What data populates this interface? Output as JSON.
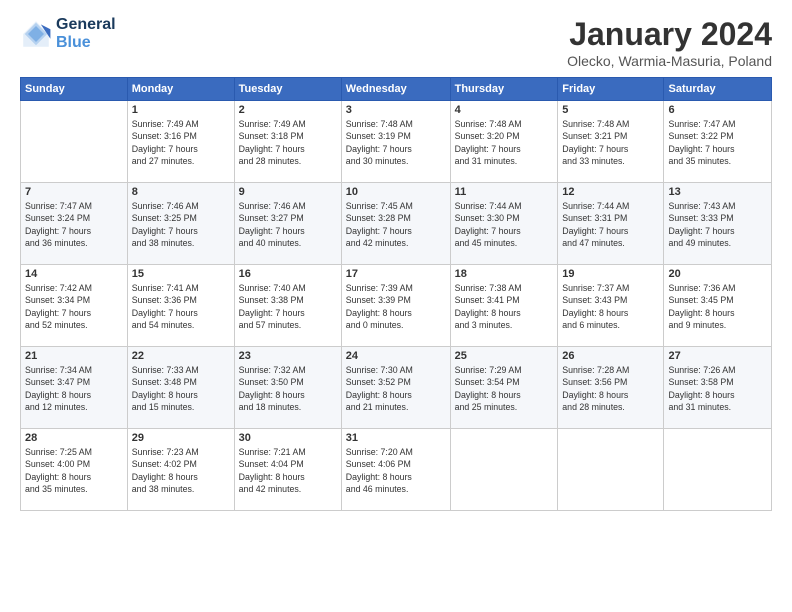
{
  "logo": {
    "line1": "General",
    "line2": "Blue"
  },
  "title": "January 2024",
  "subtitle": "Olecko, Warmia-Masuria, Poland",
  "header_days": [
    "Sunday",
    "Monday",
    "Tuesday",
    "Wednesday",
    "Thursday",
    "Friday",
    "Saturday"
  ],
  "weeks": [
    [
      {
        "day": "",
        "info": ""
      },
      {
        "day": "1",
        "info": "Sunrise: 7:49 AM\nSunset: 3:16 PM\nDaylight: 7 hours\nand 27 minutes."
      },
      {
        "day": "2",
        "info": "Sunrise: 7:49 AM\nSunset: 3:18 PM\nDaylight: 7 hours\nand 28 minutes."
      },
      {
        "day": "3",
        "info": "Sunrise: 7:48 AM\nSunset: 3:19 PM\nDaylight: 7 hours\nand 30 minutes."
      },
      {
        "day": "4",
        "info": "Sunrise: 7:48 AM\nSunset: 3:20 PM\nDaylight: 7 hours\nand 31 minutes."
      },
      {
        "day": "5",
        "info": "Sunrise: 7:48 AM\nSunset: 3:21 PM\nDaylight: 7 hours\nand 33 minutes."
      },
      {
        "day": "6",
        "info": "Sunrise: 7:47 AM\nSunset: 3:22 PM\nDaylight: 7 hours\nand 35 minutes."
      }
    ],
    [
      {
        "day": "7",
        "info": "Sunrise: 7:47 AM\nSunset: 3:24 PM\nDaylight: 7 hours\nand 36 minutes."
      },
      {
        "day": "8",
        "info": "Sunrise: 7:46 AM\nSunset: 3:25 PM\nDaylight: 7 hours\nand 38 minutes."
      },
      {
        "day": "9",
        "info": "Sunrise: 7:46 AM\nSunset: 3:27 PM\nDaylight: 7 hours\nand 40 minutes."
      },
      {
        "day": "10",
        "info": "Sunrise: 7:45 AM\nSunset: 3:28 PM\nDaylight: 7 hours\nand 42 minutes."
      },
      {
        "day": "11",
        "info": "Sunrise: 7:44 AM\nSunset: 3:30 PM\nDaylight: 7 hours\nand 45 minutes."
      },
      {
        "day": "12",
        "info": "Sunrise: 7:44 AM\nSunset: 3:31 PM\nDaylight: 7 hours\nand 47 minutes."
      },
      {
        "day": "13",
        "info": "Sunrise: 7:43 AM\nSunset: 3:33 PM\nDaylight: 7 hours\nand 49 minutes."
      }
    ],
    [
      {
        "day": "14",
        "info": "Sunrise: 7:42 AM\nSunset: 3:34 PM\nDaylight: 7 hours\nand 52 minutes."
      },
      {
        "day": "15",
        "info": "Sunrise: 7:41 AM\nSunset: 3:36 PM\nDaylight: 7 hours\nand 54 minutes."
      },
      {
        "day": "16",
        "info": "Sunrise: 7:40 AM\nSunset: 3:38 PM\nDaylight: 7 hours\nand 57 minutes."
      },
      {
        "day": "17",
        "info": "Sunrise: 7:39 AM\nSunset: 3:39 PM\nDaylight: 8 hours\nand 0 minutes."
      },
      {
        "day": "18",
        "info": "Sunrise: 7:38 AM\nSunset: 3:41 PM\nDaylight: 8 hours\nand 3 minutes."
      },
      {
        "day": "19",
        "info": "Sunrise: 7:37 AM\nSunset: 3:43 PM\nDaylight: 8 hours\nand 6 minutes."
      },
      {
        "day": "20",
        "info": "Sunrise: 7:36 AM\nSunset: 3:45 PM\nDaylight: 8 hours\nand 9 minutes."
      }
    ],
    [
      {
        "day": "21",
        "info": "Sunrise: 7:34 AM\nSunset: 3:47 PM\nDaylight: 8 hours\nand 12 minutes."
      },
      {
        "day": "22",
        "info": "Sunrise: 7:33 AM\nSunset: 3:48 PM\nDaylight: 8 hours\nand 15 minutes."
      },
      {
        "day": "23",
        "info": "Sunrise: 7:32 AM\nSunset: 3:50 PM\nDaylight: 8 hours\nand 18 minutes."
      },
      {
        "day": "24",
        "info": "Sunrise: 7:30 AM\nSunset: 3:52 PM\nDaylight: 8 hours\nand 21 minutes."
      },
      {
        "day": "25",
        "info": "Sunrise: 7:29 AM\nSunset: 3:54 PM\nDaylight: 8 hours\nand 25 minutes."
      },
      {
        "day": "26",
        "info": "Sunrise: 7:28 AM\nSunset: 3:56 PM\nDaylight: 8 hours\nand 28 minutes."
      },
      {
        "day": "27",
        "info": "Sunrise: 7:26 AM\nSunset: 3:58 PM\nDaylight: 8 hours\nand 31 minutes."
      }
    ],
    [
      {
        "day": "28",
        "info": "Sunrise: 7:25 AM\nSunset: 4:00 PM\nDaylight: 8 hours\nand 35 minutes."
      },
      {
        "day": "29",
        "info": "Sunrise: 7:23 AM\nSunset: 4:02 PM\nDaylight: 8 hours\nand 38 minutes."
      },
      {
        "day": "30",
        "info": "Sunrise: 7:21 AM\nSunset: 4:04 PM\nDaylight: 8 hours\nand 42 minutes."
      },
      {
        "day": "31",
        "info": "Sunrise: 7:20 AM\nSunset: 4:06 PM\nDaylight: 8 hours\nand 46 minutes."
      },
      {
        "day": "",
        "info": ""
      },
      {
        "day": "",
        "info": ""
      },
      {
        "day": "",
        "info": ""
      }
    ]
  ]
}
